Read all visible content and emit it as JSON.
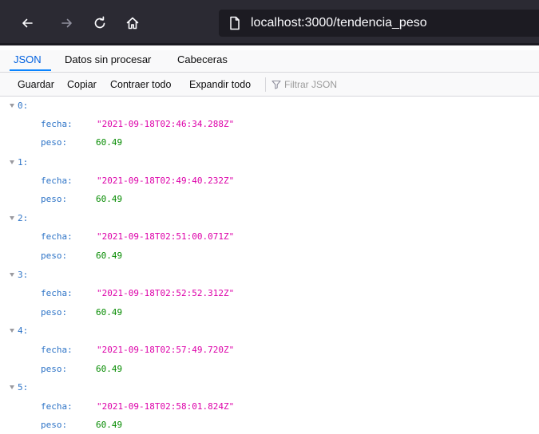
{
  "browser": {
    "url": "localhost:3000/tendencia_peso",
    "icons": {
      "back": "arrow-left-icon",
      "forward": "arrow-right-icon",
      "reload": "reload-icon",
      "home": "home-icon",
      "page": "page-icon"
    },
    "colors": {
      "toolbar_bg": "#2b2a33",
      "url_bg": "#1c1b22"
    }
  },
  "viewer": {
    "tabs": [
      {
        "label": "JSON",
        "active": true
      },
      {
        "label": "Datos sin procesar",
        "active": false
      },
      {
        "label": "Cabeceras",
        "active": false
      }
    ],
    "toolbar": {
      "save_label": "Guardar",
      "copy_label": "Copiar",
      "collapse_label": "Contraer todo",
      "expand_label": "Expandir todo",
      "filter_placeholder": "Filtrar JSON"
    },
    "colors": {
      "key": "#2e74c7",
      "string": "#dd00a9",
      "number": "#058b00",
      "accent": "#0a84ff"
    }
  },
  "records": [
    {
      "index": "0:",
      "fecha_key": "fecha:",
      "fecha": "\"2021-09-18T02:46:34.288Z\"",
      "peso_key": "peso:",
      "peso": "60.49"
    },
    {
      "index": "1:",
      "fecha_key": "fecha:",
      "fecha": "\"2021-09-18T02:49:40.232Z\"",
      "peso_key": "peso:",
      "peso": "60.49"
    },
    {
      "index": "2:",
      "fecha_key": "fecha:",
      "fecha": "\"2021-09-18T02:51:00.071Z\"",
      "peso_key": "peso:",
      "peso": "60.49"
    },
    {
      "index": "3:",
      "fecha_key": "fecha:",
      "fecha": "\"2021-09-18T02:52:52.312Z\"",
      "peso_key": "peso:",
      "peso": "60.49"
    },
    {
      "index": "4:",
      "fecha_key": "fecha:",
      "fecha": "\"2021-09-18T02:57:49.720Z\"",
      "peso_key": "peso:",
      "peso": "60.49"
    },
    {
      "index": "5:",
      "fecha_key": "fecha:",
      "fecha": "\"2021-09-18T02:58:01.824Z\"",
      "peso_key": "peso:",
      "peso": "60.49"
    }
  ]
}
